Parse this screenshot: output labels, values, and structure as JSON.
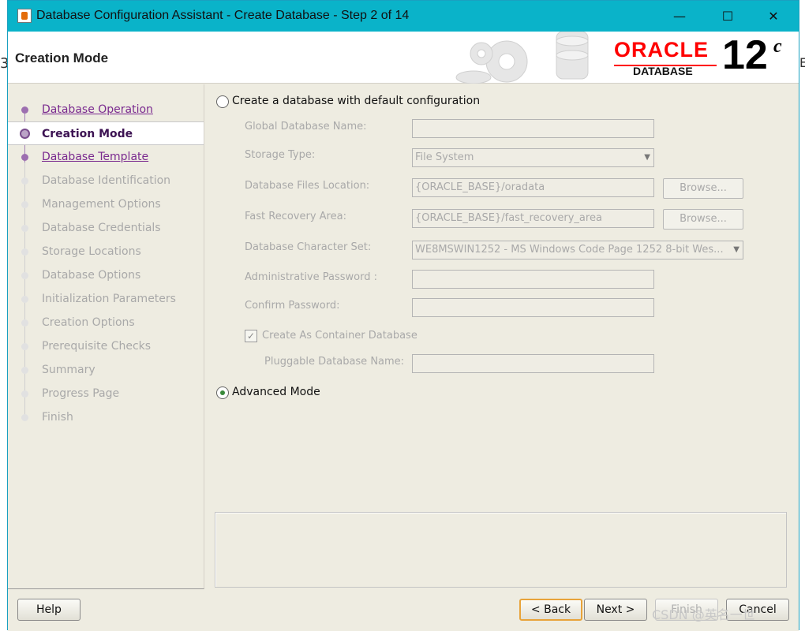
{
  "window": {
    "title": "Database Configuration Assistant - Create Database - Step 2 of 14",
    "controls": [
      "—",
      "☐",
      "✕"
    ]
  },
  "header": {
    "page_title": "Creation Mode",
    "logo": {
      "brand": "ORACLE",
      "product": "DATABASE",
      "version": "12",
      "version_suffix": "c"
    }
  },
  "steps": [
    {
      "label": "Database Operation",
      "state": "done"
    },
    {
      "label": "Creation Mode",
      "state": "active"
    },
    {
      "label": "Database Template",
      "state": "done"
    },
    {
      "label": "Database Identification",
      "state": "pending"
    },
    {
      "label": "Management Options",
      "state": "pending"
    },
    {
      "label": "Database Credentials",
      "state": "pending"
    },
    {
      "label": "Storage Locations",
      "state": "pending"
    },
    {
      "label": "Database Options",
      "state": "pending"
    },
    {
      "label": "Initialization Parameters",
      "state": "pending"
    },
    {
      "label": "Creation Options",
      "state": "pending"
    },
    {
      "label": "Prerequisite Checks",
      "state": "pending"
    },
    {
      "label": "Summary",
      "state": "pending"
    },
    {
      "label": "Progress Page",
      "state": "pending"
    },
    {
      "label": "Finish",
      "state": "pending"
    }
  ],
  "form": {
    "default_option": {
      "label": "Create a database with default configuration",
      "selected": false
    },
    "global_db_name": {
      "label": "Global Database Name:",
      "value": ""
    },
    "storage_type": {
      "label": "Storage Type:",
      "value": "File System"
    },
    "db_files_location": {
      "label": "Database Files Location:",
      "value": "{ORACLE_BASE}/oradata",
      "browse": "Browse..."
    },
    "fast_recovery_area": {
      "label": "Fast Recovery Area:",
      "value": "{ORACLE_BASE}/fast_recovery_area",
      "browse": "Browse..."
    },
    "character_set": {
      "label": "Database Character Set:",
      "value": "WE8MSWIN1252 - MS Windows Code Page 1252 8-bit Wes..."
    },
    "admin_password": {
      "label": "Administrative Password :",
      "value": ""
    },
    "confirm_password": {
      "label": "Confirm Password:",
      "value": ""
    },
    "container_db": {
      "label": "Create As Container Database",
      "checked": true
    },
    "pluggable_db_name": {
      "label": "Pluggable Database Name:",
      "value": ""
    },
    "advanced_option": {
      "label": "Advanced Mode",
      "selected": true
    }
  },
  "footer": {
    "help": "Help",
    "back": "< Back",
    "next": "Next >",
    "finish": "Finish",
    "cancel": "Cancel"
  },
  "overlay": {
    "watermark": "CSDN @英名一世"
  },
  "colors": {
    "titlebar": "#0ab3c9",
    "step_done": "#7a2a8f",
    "oracle_red": "#ff0000"
  }
}
